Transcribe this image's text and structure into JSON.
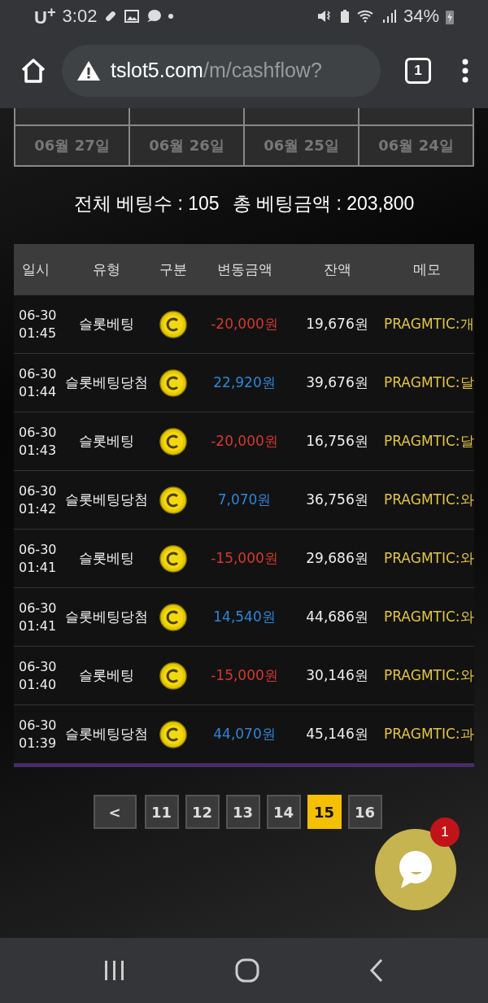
{
  "status_bar": {
    "carrier": "U$^{+}$",
    "time": "3:02",
    "battery": "34%"
  },
  "browser": {
    "url_host": "tslot5.com",
    "url_path": "/m/cashflow?",
    "tab_count": "1"
  },
  "date_grid": {
    "rows": [
      [
        "",
        "",
        "",
        ""
      ],
      [
        "06월 27일",
        "06월 26일",
        "06월 25일",
        "06월 24일"
      ]
    ]
  },
  "summary": {
    "bet_count": "전체 베팅수 : 105",
    "bet_total": "총 베팅금액 : 203,800"
  },
  "table": {
    "columns": [
      "일시",
      "유형",
      "구분",
      "변동금액",
      "잔액",
      "메모"
    ],
    "rows": [
      {
        "date": "06-30",
        "time": "01:45",
        "type": "슬롯베팅",
        "kind": "debit",
        "amount": "-20,000원",
        "balance": "19,676원",
        "memo": "PRAGMTIC:개"
      },
      {
        "date": "06-30",
        "time": "01:44",
        "type": "슬롯베팅당첨",
        "kind": "credit",
        "amount": "22,920원",
        "balance": "39,676원",
        "memo": "PRAGMTIC:달"
      },
      {
        "date": "06-30",
        "time": "01:43",
        "type": "슬롯베팅",
        "kind": "debit",
        "amount": "-20,000원",
        "balance": "16,756원",
        "memo": "PRAGMTIC:달"
      },
      {
        "date": "06-30",
        "time": "01:42",
        "type": "슬롯베팅당첨",
        "kind": "credit",
        "amount": "7,070원",
        "balance": "36,756원",
        "memo": "PRAGMTIC:와"
      },
      {
        "date": "06-30",
        "time": "01:41",
        "type": "슬롯베팅",
        "kind": "debit",
        "amount": "-15,000원",
        "balance": "29,686원",
        "memo": "PRAGMTIC:와"
      },
      {
        "date": "06-30",
        "time": "01:41",
        "type": "슬롯베팅당첨",
        "kind": "credit",
        "amount": "14,540원",
        "balance": "44,686원",
        "memo": "PRAGMTIC:와"
      },
      {
        "date": "06-30",
        "time": "01:40",
        "type": "슬롯베팅",
        "kind": "debit",
        "amount": "-15,000원",
        "balance": "30,146원",
        "memo": "PRAGMTIC:와"
      },
      {
        "date": "06-30",
        "time": "01:39",
        "type": "슬롯베팅당첨",
        "kind": "credit",
        "amount": "44,070원",
        "balance": "45,146원",
        "memo": "PRAGMTIC:과"
      }
    ]
  },
  "pagination": [
    {
      "label": "<",
      "selected": false
    },
    {
      "label": "11",
      "selected": false
    },
    {
      "label": "12",
      "selected": false
    },
    {
      "label": "13",
      "selected": false
    },
    {
      "label": "14",
      "selected": false
    },
    {
      "label": "15",
      "selected": true
    },
    {
      "label": "16",
      "selected": false
    }
  ],
  "chat": {
    "badge": "1"
  }
}
